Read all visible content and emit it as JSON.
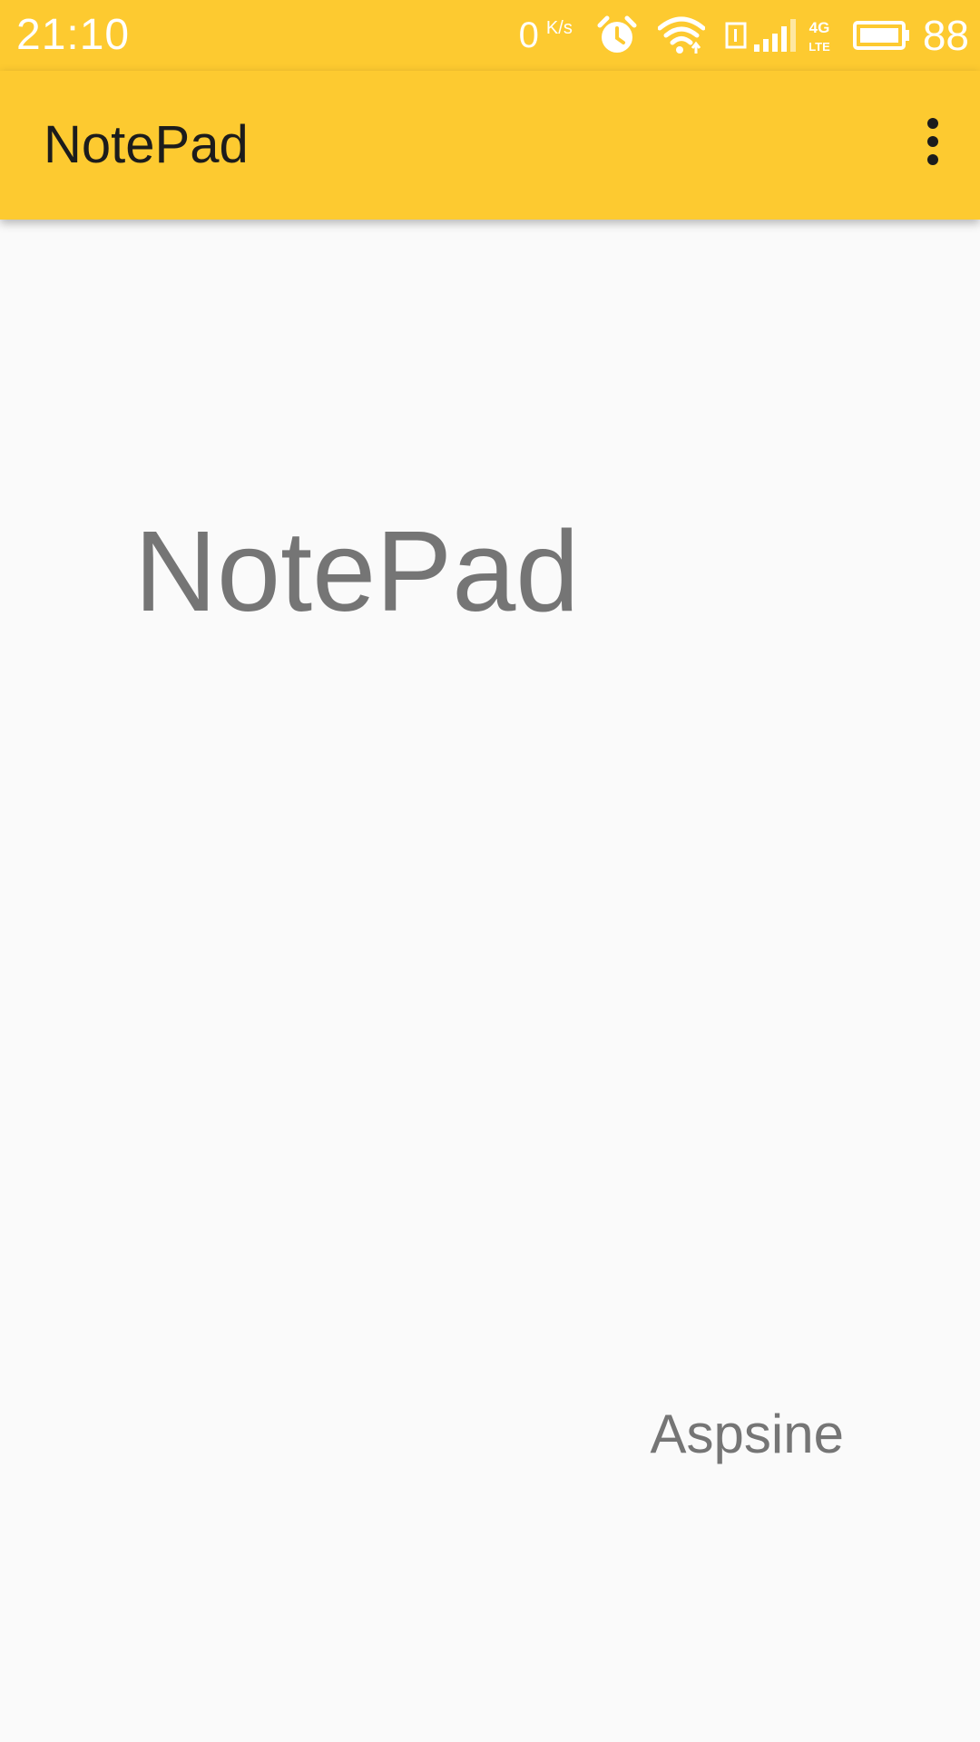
{
  "status_bar": {
    "time": "21:10",
    "net_speed_value": "0",
    "net_speed_unit": "K/s",
    "icons": [
      "alarm-icon",
      "wifi-icon",
      "sim-card-icon",
      "cellular-signal-icon",
      "4g-lte-icon",
      "battery-icon"
    ],
    "network_type_top": "4G",
    "network_type_bottom": "LTE",
    "battery_level": "88"
  },
  "app_bar": {
    "title": "NotePad",
    "menu_icon": "more-vert-icon",
    "background_color": "#fdca30"
  },
  "content": {
    "title": "NotePad",
    "author": "Aspsine"
  },
  "colors": {
    "accent": "#fdca30",
    "background": "#fafafa",
    "title_text": "#1c1c1c",
    "content_text": "#757575"
  }
}
